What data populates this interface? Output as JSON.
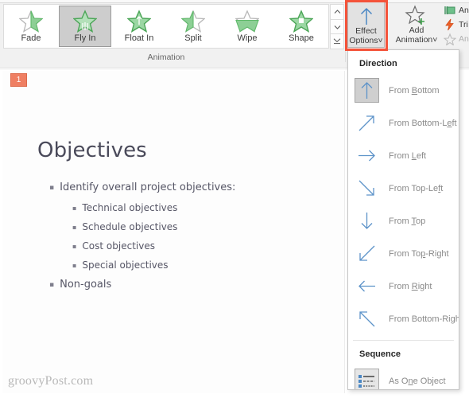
{
  "ribbon": {
    "gallery": {
      "items": [
        {
          "label": "Fade",
          "icon": "star-fade-icon",
          "selected": false
        },
        {
          "label": "Fly In",
          "icon": "star-flyin-icon",
          "selected": true
        },
        {
          "label": "Float In",
          "icon": "star-floatin-icon",
          "selected": false
        },
        {
          "label": "Split",
          "icon": "star-split-icon",
          "selected": false
        },
        {
          "label": "Wipe",
          "icon": "star-wipe-icon",
          "selected": false
        },
        {
          "label": "Shape",
          "icon": "star-shape-icon",
          "selected": false
        }
      ],
      "scroll_up": "scroll-up-icon",
      "scroll_down": "scroll-down-icon",
      "more": "gallery-more-icon"
    },
    "group_label": "Animation",
    "effect_options": {
      "label_line1": "Effect",
      "label_line2": "Options",
      "icon": "arrow-up-icon",
      "dropdown_caret": "˅",
      "highlighted": true,
      "highlight_color": "#f4533a"
    },
    "add_animation": {
      "label_line1": "Add",
      "label_line2": "Animation",
      "icon": "star-plus-icon",
      "dropdown_caret": "˅"
    },
    "advanced_commands": [
      {
        "label": "Ani",
        "icon": "animation-pane-icon",
        "dimmed": false
      },
      {
        "label": "Tri",
        "icon": "trigger-lightning-icon",
        "dimmed": false
      },
      {
        "label": "Ani",
        "icon": "animation-painter-icon",
        "dimmed": true
      }
    ]
  },
  "slide": {
    "animation_order_badge": "1",
    "title": "Objectives",
    "bullets": [
      {
        "level": 1,
        "text": "Identify overall project objectives:"
      },
      {
        "level": 2,
        "text": "Technical objectives"
      },
      {
        "level": 2,
        "text": "Schedule objectives"
      },
      {
        "level": 2,
        "text": "Cost objectives"
      },
      {
        "level": 2,
        "text": "Special objectives"
      },
      {
        "level": 1,
        "text": "Non-goals"
      }
    ],
    "watermark": "groovyPost.com"
  },
  "effect_menu": {
    "direction_header": "Direction",
    "directions": [
      {
        "pre": "From ",
        "key": "B",
        "post": "ottom",
        "icon": "arrow-up-icon",
        "selected": true
      },
      {
        "pre": "From Bottom-L",
        "key": "e",
        "post": "ft",
        "icon": "arrow-up-right-icon",
        "selected": false
      },
      {
        "pre": "From ",
        "key": "L",
        "post": "eft",
        "icon": "arrow-right-icon",
        "selected": false
      },
      {
        "pre": "From Top-Le",
        "key": "f",
        "post": "t",
        "icon": "arrow-down-right-icon",
        "selected": false
      },
      {
        "pre": "From ",
        "key": "T",
        "post": "op",
        "icon": "arrow-down-icon",
        "selected": false
      },
      {
        "pre": "From To",
        "key": "p",
        "post": "-Right",
        "icon": "arrow-down-left-icon",
        "selected": false
      },
      {
        "pre": "From ",
        "key": "R",
        "post": "ight",
        "icon": "arrow-left-icon",
        "selected": false
      },
      {
        "pre": "From Bottom-Ri",
        "key": "g",
        "post": "ht",
        "icon": "arrow-up-left-icon",
        "selected": false
      }
    ],
    "sequence_header": "Sequence",
    "sequence_items": [
      {
        "pre": "As O",
        "key": "n",
        "post": "e Object",
        "icon": "as-one-object-icon",
        "selected": true
      }
    ]
  },
  "colors": {
    "accent_blue": "#4a87c4",
    "star_green": "#5fb96a",
    "badge_orange": "#ef7f63",
    "highlight_red": "#f4533a",
    "menu_text": "#8a8a8a"
  }
}
